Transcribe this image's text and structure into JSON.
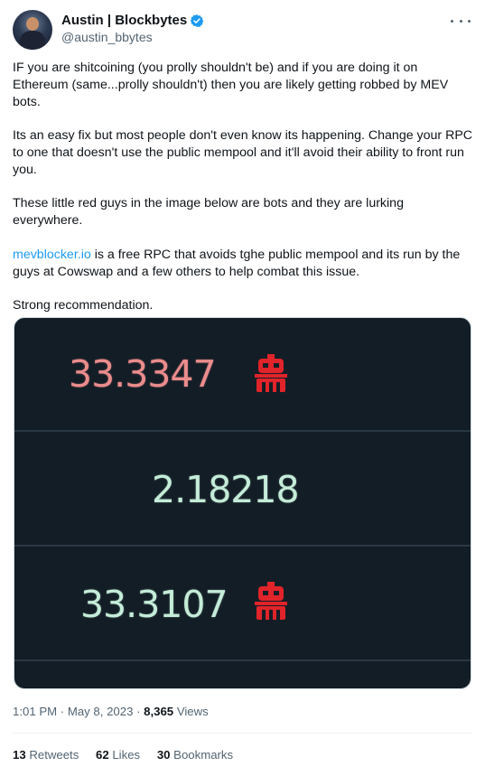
{
  "author": {
    "name": "Austin | Blockbytes",
    "handle": "@austin_bbytes",
    "verified": true
  },
  "tweet": {
    "paragraph1": "IF you are shitcoining (you prolly shouldn't be) and if you are doing it on Ethereum (same...prolly shouldn't) then you are likely getting robbed by MEV bots.",
    "paragraph2": "Its an easy fix but most people don't even know its happening. Change your RPC to one that doesn't use the public mempool and it'll avoid their ability to front run you.",
    "paragraph3": "These little red guys in the image below are bots and they are lurking everywhere.",
    "link_text": "mevblocker.io",
    "paragraph4_rest": " is a free RPC that avoids tghe public mempool and its run by the guys at Cowswap and a few others to help combat this issue.",
    "paragraph5": "Strong recommendation."
  },
  "image": {
    "rows": [
      {
        "value": "33.3347",
        "color": "#eb8c8c",
        "bot_icon": "bot-icon"
      },
      {
        "value": "2.18218",
        "color": "#c4ecd8"
      },
      {
        "value": "33.3107",
        "color": "#c4ecd8",
        "bot_icon": "bot-icon"
      }
    ],
    "bot_color": "#e0242a",
    "background": "#131d26"
  },
  "meta": {
    "time_date": "1:01 PM · May 8, 2023 · ",
    "views_count": "8,365",
    "views_label": " Views"
  },
  "stats": {
    "retweets_count": "13",
    "retweets_label": "Retweets",
    "likes_count": "62",
    "likes_label": "Likes",
    "bookmarks_count": "30",
    "bookmarks_label": "Bookmarks"
  },
  "colors": {
    "accent": "#1d9bf0",
    "secondary_text": "#536471"
  }
}
